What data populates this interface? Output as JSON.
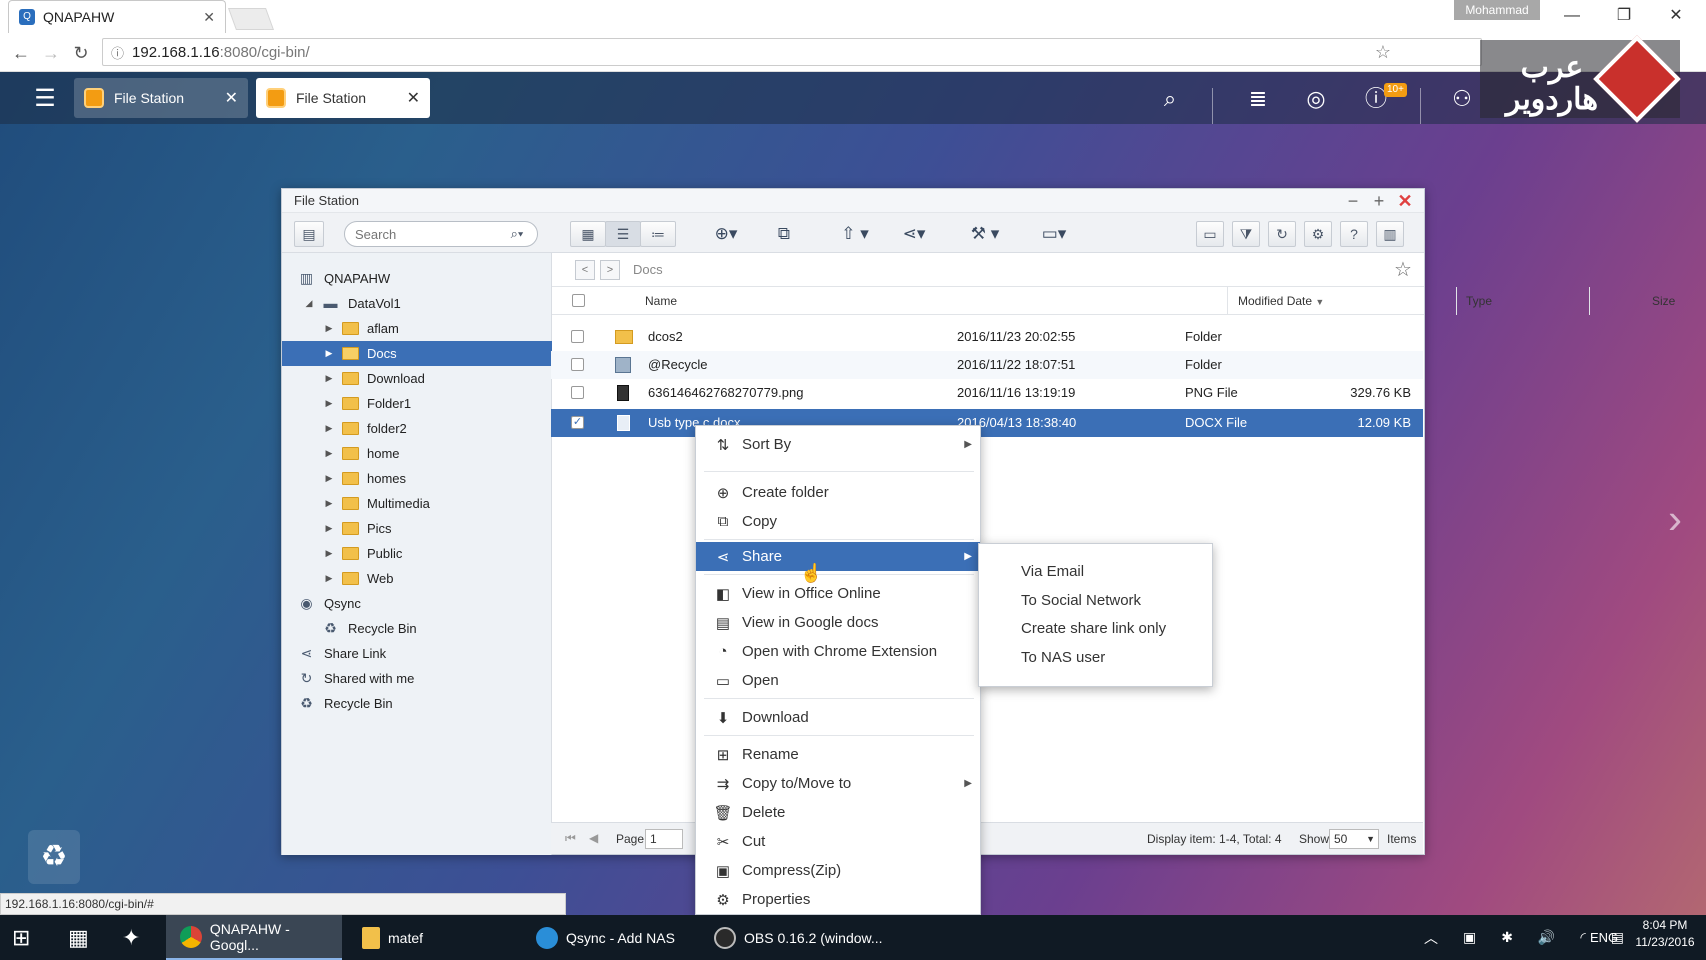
{
  "browser": {
    "tab_title": "QNAPAHW",
    "user": "Mohammad",
    "url_host": "192.168.1.16",
    "url_rest": ":8080/cgi-bin/",
    "status_url": "192.168.1.16:8080/cgi-bin/#"
  },
  "qnap": {
    "tabs": [
      {
        "label": "File Station"
      },
      {
        "label": "File Station"
      }
    ],
    "badge": "10+",
    "logo_text": "عرب هاردوير"
  },
  "window": {
    "title": "File Station",
    "search_placeholder": "Search",
    "breadcrumb": "Docs"
  },
  "tree": [
    {
      "label": "QNAPAHW"
    },
    {
      "label": "DataVol1"
    },
    {
      "label": "aflam"
    },
    {
      "label": "Docs"
    },
    {
      "label": "Download"
    },
    {
      "label": "Folder1"
    },
    {
      "label": "folder2"
    },
    {
      "label": "home"
    },
    {
      "label": "homes"
    },
    {
      "label": "Multimedia"
    },
    {
      "label": "Pics"
    },
    {
      "label": "Public"
    },
    {
      "label": "Web"
    },
    {
      "label": "Qsync"
    },
    {
      "label": "Recycle Bin"
    },
    {
      "label": "Share Link"
    },
    {
      "label": "Shared with me"
    },
    {
      "label": "Recycle Bin"
    }
  ],
  "columns": {
    "name": "Name",
    "modified": "Modified Date",
    "type": "Type",
    "size": "Size"
  },
  "files": [
    {
      "name": "dcos2",
      "modified": "2016/11/23 20:02:55",
      "type": "Folder",
      "size": ""
    },
    {
      "name": "@Recycle",
      "modified": "2016/11/22 18:07:51",
      "type": "Folder",
      "size": ""
    },
    {
      "name": "636146462768270779.png",
      "modified": "2016/11/16 13:19:19",
      "type": "PNG File",
      "size": "329.76 KB"
    },
    {
      "name": "Usb type c.docx",
      "modified": "2016/04/13 18:38:40",
      "type": "DOCX File",
      "size": "12.09 KB"
    }
  ],
  "statusbar": {
    "page_label": "Page",
    "page_value": "1",
    "display": "Display item: 1-4, Total: 4",
    "show": "Show",
    "show_value": "50",
    "items": "Items"
  },
  "context_menu": [
    {
      "label": "Sort By"
    },
    {
      "label": "Create folder"
    },
    {
      "label": "Copy"
    },
    {
      "label": "Share"
    },
    {
      "label": "View in Office Online"
    },
    {
      "label": "View in Google docs"
    },
    {
      "label": "Open with Chrome Extension"
    },
    {
      "label": "Open"
    },
    {
      "label": "Download"
    },
    {
      "label": "Rename"
    },
    {
      "label": "Copy to/Move to"
    },
    {
      "label": "Delete"
    },
    {
      "label": "Cut"
    },
    {
      "label": "Compress(Zip)"
    },
    {
      "label": "Properties"
    }
  ],
  "share_submenu": [
    {
      "label": "Via Email"
    },
    {
      "label": "To Social Network"
    },
    {
      "label": "Create share link only"
    },
    {
      "label": "To NAS user"
    }
  ],
  "taskbar": {
    "items": [
      {
        "label": "QNAPAHW - Googl..."
      },
      {
        "label": "matef"
      },
      {
        "label": "Qsync - Add NAS"
      },
      {
        "label": "OBS 0.16.2 (window..."
      }
    ],
    "lang": "ENG",
    "time": "8:04 PM",
    "date": "11/23/2016"
  },
  "colors": {
    "accent": "#3b6fb6",
    "folder": "#f2c04a",
    "taskbar": "#101a24"
  }
}
